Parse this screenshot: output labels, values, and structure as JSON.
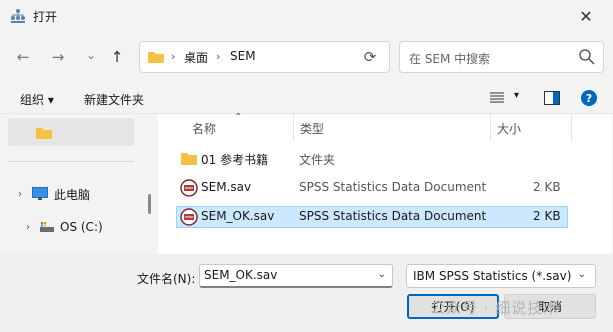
{
  "window": {
    "title": "打开",
    "close_glyph": "✕"
  },
  "nav": {
    "back_glyph": "←",
    "forward_glyph": "→",
    "recent_glyph": "⌄",
    "up_glyph": "↑",
    "refresh_glyph": "⟳",
    "breadcrumb": [
      "桌面",
      "SEM"
    ],
    "breadcrumb_sep": "›",
    "dropdown_glyph": "⌄"
  },
  "search": {
    "placeholder": "在 SEM 中搜索"
  },
  "commandbar": {
    "organize": "组织 ▾",
    "new_folder": "新建文件夹",
    "view_dd": "▾",
    "help": "?"
  },
  "sidebar": {
    "tree": [
      {
        "chev": "›",
        "label": "此电脑"
      },
      {
        "chev": "›",
        "label": "OS (C:)"
      }
    ]
  },
  "columns": {
    "name": "名称",
    "type": "类型",
    "size": "大小",
    "sort_glyph": "⌃"
  },
  "files": [
    {
      "name": "01 参考书籍",
      "type": "文件夹",
      "size": "",
      "icon": "folder-icon"
    },
    {
      "name": "SEM.sav",
      "type": "SPSS Statistics Data Document",
      "size": "2 KB",
      "icon": "spss-file-icon"
    },
    {
      "name": "SEM_OK.sav",
      "type": "SPSS Statistics Data Document",
      "size": "2 KB",
      "icon": "spss-file-icon",
      "selected": true
    }
  ],
  "bottom": {
    "filename_label": "文件名(N):",
    "filename_value": "SEM_OK.sav",
    "filetype_value": "IBM SPSS Statistics (*.sav)",
    "dd_glyph": "⌄",
    "open_button": "打开(O)",
    "cancel_button": "取消",
    "watermark": "公众号 · 细说技术"
  },
  "colors": {
    "accent": "#0067c0",
    "selected_row": "#cce8ff",
    "folder": "#f5c242"
  }
}
